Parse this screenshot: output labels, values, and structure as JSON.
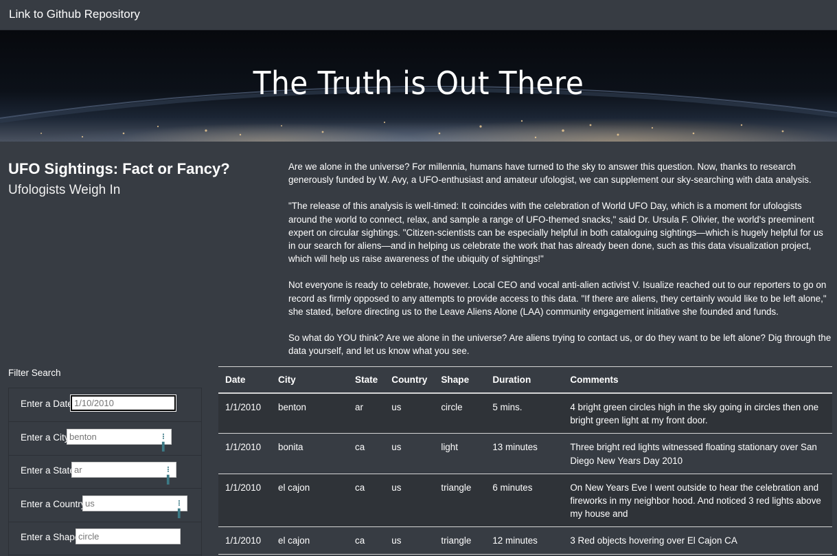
{
  "navbar": {
    "link_label": "Link to Github Repository"
  },
  "hero": {
    "title": "The Truth is Out There"
  },
  "intro": {
    "title_strong": "UFO Sightings: Fact or Fancy?",
    "title_muted": "Ufologists Weigh In"
  },
  "article": {
    "paragraphs": [
      "Are we alone in the universe? For millennia, humans have turned to the sky to answer this question. Now, thanks to research generously funded by W. Avy, a UFO-enthusiast and amateur ufologist, we can supplement our sky-searching with data analysis.",
      "\"The release of this analysis is well-timed: It coincides with the celebration of World UFO Day, which is a moment for ufologists around the world to connect, relax, and sample a range of UFO-themed snacks,\" said Dr. Ursula F. Olivier, the world's preeminent expert on circular sightings. \"Citizen-scientists can be especially helpful in both cataloguing sightings—which is hugely helpful for us in our search for aliens—and in helping us celebrate the work that has already been done, such as this data visualization project, which will help us raise awareness of the ubiquity of sightings!\"",
      "Not everyone is ready to celebrate, however. Local CEO and vocal anti-alien activist V. Isualize reached out to our reporters to go on record as firmly opposed to any attempts to provide access to this data. \"If there are aliens, they certainly would like to be left alone,\" she stated, before directing us to the Leave Aliens Alone (LAA) community engagement initiative she founded and funds.",
      "So what do YOU think? Are we alone in the universe? Are aliens trying to contact us, or do they want to be left alone? Dig through the data yourself, and let us know what you see."
    ]
  },
  "filters": {
    "heading": "Filter Search",
    "date": {
      "label": "Enter a Date",
      "value": "1/10/2010"
    },
    "city": {
      "label": "Enter a City",
      "value": "benton"
    },
    "state": {
      "label": "Enter a State",
      "value": "ar"
    },
    "country": {
      "label": "Enter a Country",
      "value": "us"
    },
    "shape": {
      "label": "Enter a Shape",
      "value": "circle"
    }
  },
  "table": {
    "headers": [
      "Date",
      "City",
      "State",
      "Country",
      "Shape",
      "Duration",
      "Comments"
    ],
    "rows": [
      [
        "1/1/2010",
        "benton",
        "ar",
        "us",
        "circle",
        "5 mins.",
        "4 bright green circles high in the sky going in circles then one bright green light at my front door."
      ],
      [
        "1/1/2010",
        "bonita",
        "ca",
        "us",
        "light",
        "13 minutes",
        "Three bright red lights witnessed floating stationary over San Diego New Years Day 2010"
      ],
      [
        "1/1/2010",
        "el cajon",
        "ca",
        "us",
        "triangle",
        "6 minutes",
        "On New Years Eve I went outside to hear the celebration and fireworks in my neighbor hood. And noticed 3 red lights above my house and"
      ],
      [
        "1/1/2010",
        "el cajon",
        "ca",
        "us",
        "triangle",
        "12 minutes",
        "3 Red objects hovering over El Cajon CA"
      ]
    ]
  }
}
